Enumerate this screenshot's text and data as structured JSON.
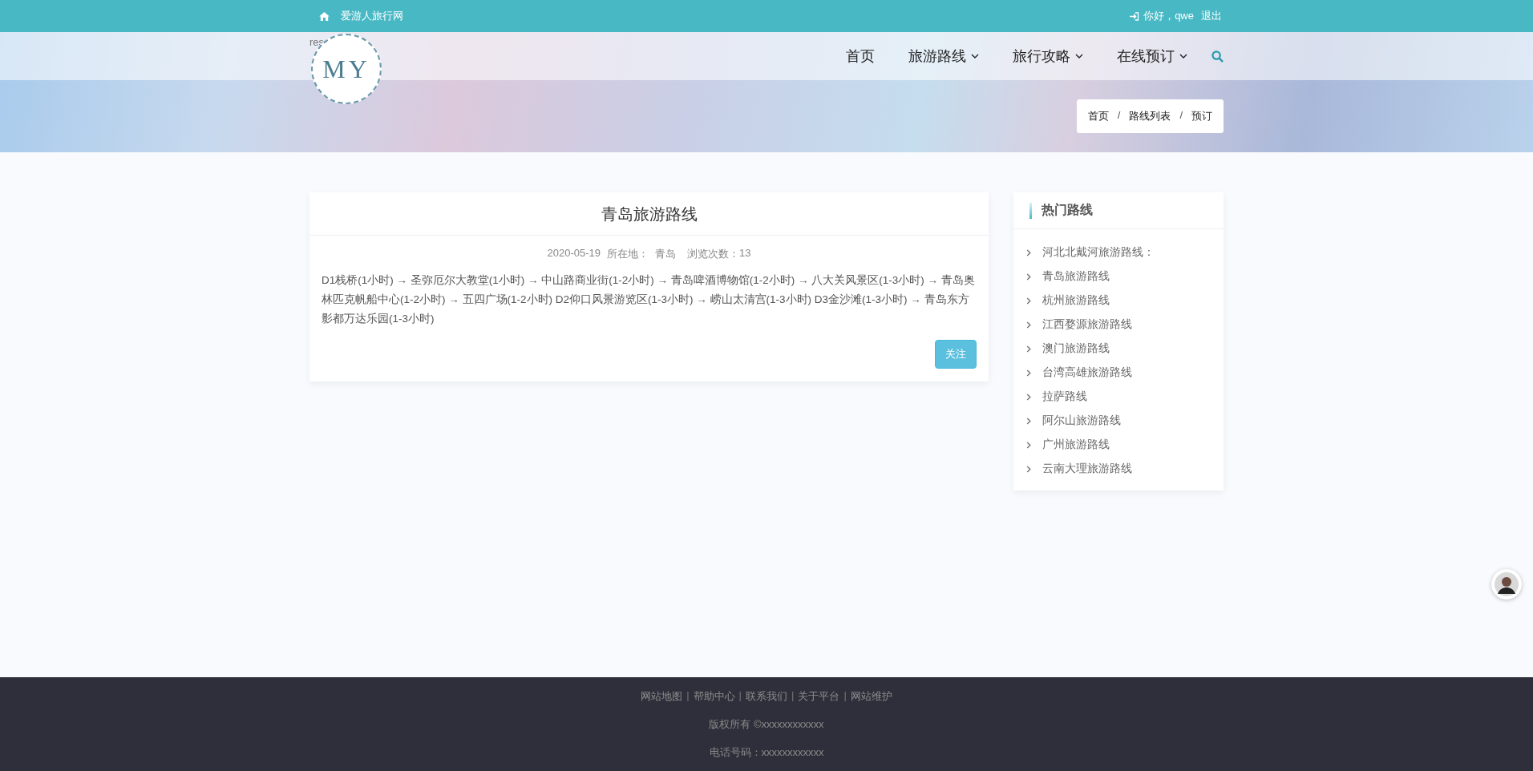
{
  "top_bar": {
    "site_name": "爱游人旅行网",
    "greeting": "你好，qwe",
    "logout": "退出"
  },
  "header": {
    "logo_text": "MY",
    "logo_alt": "res",
    "nav": [
      {
        "label": "首页",
        "dropdown": false
      },
      {
        "label": "旅游路线",
        "dropdown": true
      },
      {
        "label": "旅行攻略",
        "dropdown": true
      },
      {
        "label": "在线预订",
        "dropdown": true
      }
    ]
  },
  "breadcrumb": [
    {
      "kind": "link",
      "text": "首页"
    },
    {
      "kind": "separator",
      "text": "/"
    },
    {
      "kind": "link",
      "text": "路线列表"
    },
    {
      "kind": "separator",
      "text": "/"
    },
    {
      "kind": "current",
      "text": "预订"
    }
  ],
  "article": {
    "title": "青岛旅游路线",
    "date": "2020-05-19",
    "location_label": "所在地：",
    "location": "青岛",
    "views_label": "浏览次数：",
    "views": "13",
    "body": "D1栈桥(1小时) → 圣弥厄尔大教堂(1小时) → 中山路商业街(1-2小时) → 青岛啤酒博物馆(1-2小时) → 八大关风景区(1-3小时) → 青岛奥林匹克帆船中心(1-2小时) → 五四广场(1-2小时) D2仰口风景游览区(1-3小时) → 崂山太清宫(1-3小时) D3金沙滩(1-3小时) → 青岛东方影都万达乐园(1-3小时)",
    "follow_button": "关注"
  },
  "sidebar": {
    "title": "热门路线",
    "items": [
      "河北北戴河旅游路线：",
      "青岛旅游路线",
      "杭州旅游路线",
      "江西婺源旅游路线",
      "澳门旅游路线",
      "台湾高雄旅游路线",
      "拉萨路线",
      "阿尔山旅游路线",
      "广州旅游路线",
      "云南大理旅游路线"
    ]
  },
  "footer": {
    "links": [
      {
        "kind": "link",
        "text": "网站地图"
      },
      {
        "kind": "separator",
        "text": "|"
      },
      {
        "kind": "link",
        "text": "帮助中心"
      },
      {
        "kind": "separator",
        "text": "|"
      },
      {
        "kind": "link",
        "text": "联系我们"
      },
      {
        "kind": "separator",
        "text": "|"
      },
      {
        "kind": "link",
        "text": "关于平台"
      },
      {
        "kind": "separator",
        "text": "|"
      },
      {
        "kind": "link",
        "text": "网站维护"
      }
    ],
    "copyright": "版权所有 ©xxxxxxxxxxxx",
    "phone": "电话号码：xxxxxxxxxxxx"
  }
}
